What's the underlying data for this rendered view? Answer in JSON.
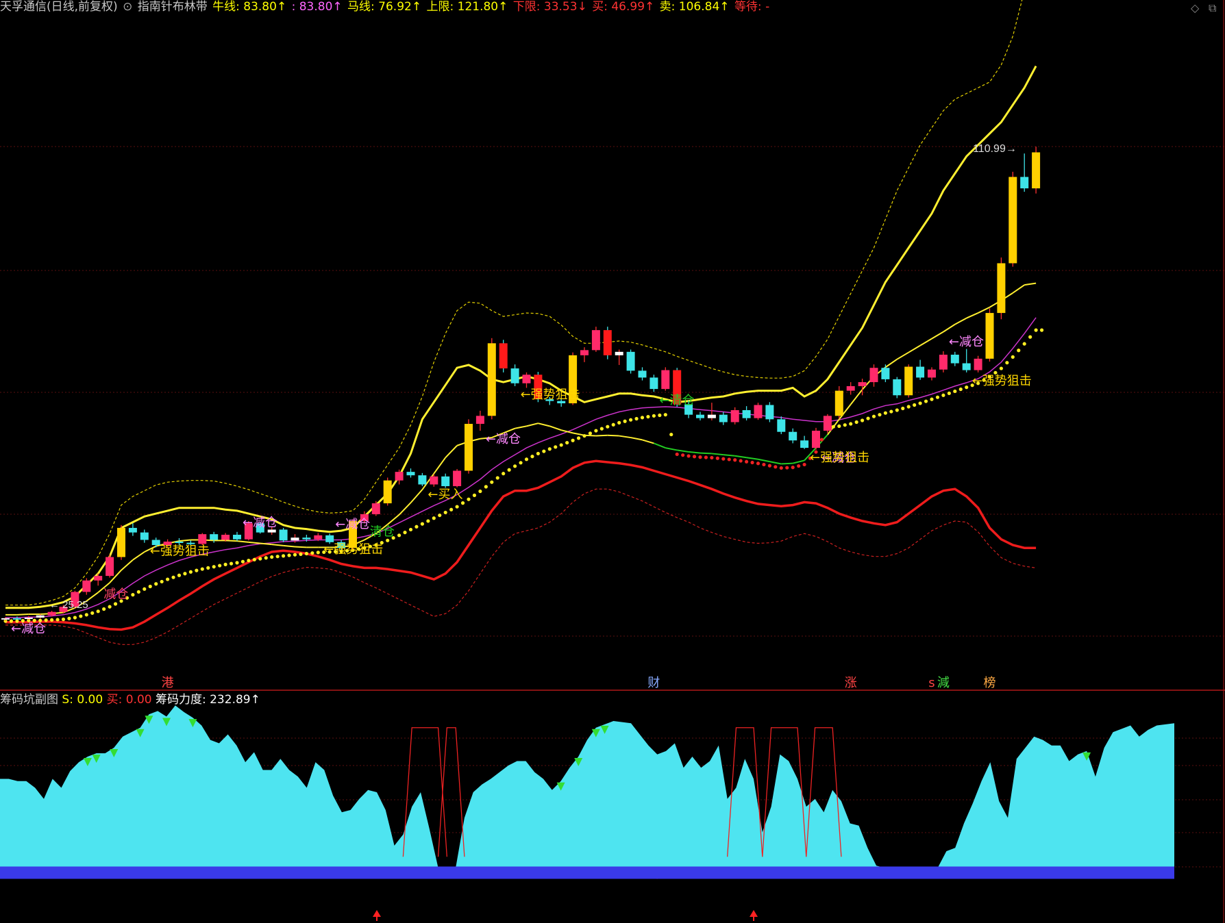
{
  "header": {
    "items": [
      {
        "text": "天孚通信(日线,前复权)",
        "color": "#c8c8c8"
      },
      {
        "text": "⊙",
        "color": "#aaaaaa"
      },
      {
        "text": "指南针布林带",
        "color": "#c8c8c8"
      },
      {
        "text": "牛线: 83.80↑",
        "color": "#ffff00"
      },
      {
        "text": ": 83.80↑",
        "color": "#ff66ff"
      },
      {
        "text": "马线: 76.92↑",
        "color": "#ffff00"
      },
      {
        "text": "上限: 121.80↑",
        "color": "#ffff00"
      },
      {
        "text": "下限: 33.53↓",
        "color": "#ff3333"
      },
      {
        "text": "买: 46.99↑",
        "color": "#ff3333"
      },
      {
        "text": "卖: 106.84↑",
        "color": "#ffff00"
      },
      {
        "text": "等待: -",
        "color": "#ff3333"
      }
    ]
  },
  "toolbar": {
    "diamond": "◇",
    "restore": "⧉"
  },
  "subheader": {
    "items": [
      {
        "text": "筹码坑副图",
        "color": "#c8c8c8"
      },
      {
        "text": "S: 0.00",
        "color": "#ffff00"
      },
      {
        "text": "买: 0.00",
        "color": "#ff3333"
      },
      {
        "text": "筹码力度: 232.89↑",
        "color": "#ffffff"
      }
    ]
  },
  "chart_data": {
    "type": "line",
    "candles": [
      [
        25.0,
        25.4,
        24.8,
        25.2
      ],
      [
        25.2,
        25.5,
        25.0,
        25.1
      ],
      [
        25.1,
        25.6,
        24.9,
        25.3
      ],
      [
        25.3,
        25.9,
        25.1,
        25.7
      ],
      [
        25.7,
        26.5,
        25.5,
        26.3
      ],
      [
        26.3,
        27.5,
        26.0,
        27.2
      ],
      [
        27.2,
        30.0,
        26.9,
        29.8
      ],
      [
        29.8,
        32.2,
        29.3,
        31.8
      ],
      [
        31.8,
        33.0,
        30.9,
        32.6
      ],
      [
        32.6,
        36.3,
        32.3,
        35.9
      ],
      [
        35.9,
        41.5,
        35.4,
        41.0
      ],
      [
        41.0,
        41.8,
        39.6,
        40.2
      ],
      [
        40.2,
        40.7,
        38.4,
        38.9
      ],
      [
        38.9,
        39.3,
        37.6,
        38.0
      ],
      [
        38.0,
        39.0,
        37.5,
        38.6
      ],
      [
        38.6,
        39.2,
        38.0,
        38.4
      ],
      [
        38.4,
        38.8,
        37.9,
        38.2
      ],
      [
        38.2,
        40.1,
        38.0,
        39.9
      ],
      [
        39.9,
        40.3,
        38.4,
        38.9
      ],
      [
        38.9,
        40.1,
        38.6,
        39.8
      ],
      [
        39.8,
        40.3,
        38.7,
        39.0
      ],
      [
        39.0,
        42.2,
        38.8,
        41.8
      ],
      [
        41.8,
        42.0,
        40.0,
        40.2
      ],
      [
        40.2,
        41.1,
        39.8,
        40.7
      ],
      [
        40.7,
        41.0,
        38.5,
        38.8
      ],
      [
        38.8,
        39.9,
        38.4,
        39.3
      ],
      [
        39.3,
        39.8,
        38.6,
        39.0
      ],
      [
        39.0,
        40.1,
        38.7,
        39.7
      ],
      [
        39.7,
        40.0,
        38.2,
        38.5
      ],
      [
        38.5,
        38.9,
        37.2,
        37.5
      ],
      [
        37.5,
        42.5,
        37.3,
        42.2
      ],
      [
        42.2,
        43.9,
        41.8,
        43.4
      ],
      [
        43.4,
        45.7,
        43.1,
        45.3
      ],
      [
        45.3,
        49.8,
        44.9,
        49.3
      ],
      [
        49.3,
        51.2,
        48.6,
        50.8
      ],
      [
        50.8,
        51.4,
        49.8,
        50.2
      ],
      [
        50.2,
        50.6,
        48.3,
        48.6
      ],
      [
        48.6,
        50.4,
        48.2,
        50.0
      ],
      [
        50.0,
        50.5,
        48.0,
        48.3
      ],
      [
        48.3,
        51.3,
        48.1,
        51.0
      ],
      [
        51.0,
        60.0,
        50.5,
        59.2
      ],
      [
        59.2,
        61.5,
        58.0,
        60.6
      ],
      [
        60.6,
        74.2,
        60.0,
        73.3
      ],
      [
        73.3,
        73.9,
        68.2,
        68.9
      ],
      [
        68.9,
        69.6,
        65.8,
        66.3
      ],
      [
        66.3,
        68.2,
        65.5,
        67.8
      ],
      [
        67.8,
        68.3,
        63.0,
        63.5
      ],
      [
        63.5,
        63.9,
        62.5,
        63.2
      ],
      [
        63.2,
        63.6,
        62.2,
        62.8
      ],
      [
        62.8,
        71.7,
        62.5,
        71.2
      ],
      [
        71.2,
        72.6,
        70.0,
        72.1
      ],
      [
        72.1,
        76.2,
        71.8,
        75.6
      ],
      [
        75.6,
        76.2,
        70.5,
        71.2
      ],
      [
        71.2,
        72.2,
        69.5,
        71.8
      ],
      [
        71.8,
        72.2,
        68.0,
        68.5
      ],
      [
        68.5,
        69.1,
        66.8,
        67.3
      ],
      [
        67.3,
        67.8,
        64.8,
        65.3
      ],
      [
        65.3,
        69.1,
        65.0,
        68.6
      ],
      [
        68.6,
        69.0,
        62.2,
        62.6
      ],
      [
        62.6,
        63.3,
        60.2,
        60.8
      ],
      [
        60.8,
        61.3,
        59.8,
        60.2
      ],
      [
        60.2,
        62.9,
        59.8,
        60.8
      ],
      [
        60.8,
        61.3,
        59.0,
        59.5
      ],
      [
        59.5,
        62.1,
        59.1,
        61.6
      ],
      [
        61.6,
        62.3,
        59.8,
        60.2
      ],
      [
        60.2,
        62.9,
        59.9,
        62.5
      ],
      [
        62.5,
        63.0,
        59.5,
        60.0
      ],
      [
        60.0,
        60.5,
        57.4,
        57.8
      ],
      [
        57.8,
        58.4,
        55.8,
        56.3
      ],
      [
        56.3,
        57.1,
        54.8,
        55.0
      ],
      [
        55.0,
        58.5,
        54.7,
        58.0
      ],
      [
        58.0,
        60.9,
        57.6,
        60.6
      ],
      [
        60.6,
        65.8,
        60.1,
        65.0
      ],
      [
        65.0,
        66.5,
        64.3,
        65.8
      ],
      [
        65.8,
        67.1,
        64.2,
        66.5
      ],
      [
        66.5,
        69.6,
        65.7,
        69.0
      ],
      [
        69.0,
        69.6,
        66.5,
        67.0
      ],
      [
        67.0,
        67.4,
        63.7,
        64.2
      ],
      [
        64.2,
        69.6,
        63.8,
        69.2
      ],
      [
        69.2,
        70.4,
        66.9,
        67.3
      ],
      [
        67.3,
        69.1,
        66.8,
        68.7
      ],
      [
        68.7,
        71.9,
        68.2,
        71.3
      ],
      [
        71.3,
        71.8,
        69.3,
        69.8
      ],
      [
        69.8,
        72.3,
        68.2,
        68.6
      ],
      [
        68.6,
        71.1,
        68.2,
        70.6
      ],
      [
        70.6,
        79.4,
        70.1,
        78.6
      ],
      [
        78.6,
        88.3,
        77.5,
        87.3
      ],
      [
        87.3,
        103.3,
        86.7,
        102.4
      ],
      [
        102.4,
        106.5,
        99.8,
        100.4
      ],
      [
        100.4,
        107.7,
        99.5,
        106.7
      ]
    ],
    "last_price_label": "110.99",
    "low_price_label": "25.25",
    "upper_band": [
      27,
      27,
      27,
      27.2,
      27.5,
      28,
      29,
      31,
      33,
      36,
      41,
      42,
      43,
      43.5,
      44,
      44.5,
      44.5,
      44.5,
      44.5,
      44.2,
      44,
      43.5,
      43,
      42.5,
      41.5,
      41,
      40.8,
      40.5,
      40.3,
      40.5,
      41,
      43,
      45,
      47,
      50,
      54,
      60,
      63,
      66,
      69,
      69.5,
      68.5,
      67,
      66.5,
      67,
      67.5,
      67,
      66.3,
      65,
      64,
      63,
      63.5,
      64,
      64.5,
      64.5,
      64.2,
      64,
      63.5,
      63,
      63.2,
      63.5,
      63.8,
      64,
      64.5,
      64.8,
      65,
      65,
      65,
      65.5,
      64,
      65,
      67,
      70,
      73,
      76,
      80,
      84,
      87,
      90,
      93,
      96,
      100,
      103,
      106,
      108,
      110,
      112,
      115,
      118,
      121.8
    ],
    "middle_band": [
      25.8,
      25.8,
      25.9,
      25.9,
      26,
      26.2,
      27,
      28.2,
      29.7,
      31.4,
      33.6,
      35.4,
      36.8,
      37.8,
      38.3,
      38.7,
      38.9,
      38.9,
      38.8,
      38.8,
      38.7,
      38.5,
      38.3,
      38.1,
      37.9,
      37.7,
      37.6,
      37.6,
      37.6,
      37.6,
      38,
      38.9,
      40,
      41.6,
      43.3,
      45.4,
      47.7,
      50.5,
      53.3,
      55.4,
      56.1,
      56.6,
      56.8,
      57.6,
      58.4,
      58.8,
      59.3,
      58.8,
      58.1,
      57.6,
      57.2,
      57.1,
      57.2,
      57.1,
      56.8,
      56.4,
      55.8,
      55,
      54.6,
      54.3,
      54.1,
      54,
      53.8,
      53.6,
      53.3,
      53,
      52.6,
      52.2,
      52.3,
      52.8,
      55,
      57.3,
      60,
      62.6,
      65.2,
      67.5,
      69.1,
      70.5,
      71.7,
      72.9,
      74.1,
      75.3,
      76.6,
      77.7,
      78.6,
      79.6,
      80.8,
      82.1,
      83.5,
      83.8
    ],
    "lower_band": [
      24.5,
      24.5,
      24.5,
      24.6,
      24.6,
      24.5,
      24.3,
      24,
      23.6,
      23.3,
      23.2,
      23.6,
      24.6,
      25.8,
      27,
      28.3,
      29.5,
      30.8,
      32,
      33,
      34,
      35,
      36,
      36.8,
      37,
      36.8,
      36.5,
      36,
      35.4,
      34.7,
      34.3,
      34,
      34,
      33.8,
      33.5,
      33.2,
      32.6,
      32,
      33,
      35,
      38,
      41,
      44,
      46.5,
      47.5,
      47.5,
      48,
      49,
      50,
      51.5,
      52.4,
      52.7,
      52.5,
      52.3,
      52,
      51.6,
      51,
      50.4,
      49.8,
      49.2,
      48.5,
      47.8,
      47,
      46.3,
      45.7,
      45.2,
      45,
      44.8,
      45,
      45.5,
      45.3,
      44.5,
      43.5,
      42.8,
      42.2,
      41.8,
      41.5,
      42,
      43.5,
      45,
      46.5,
      47.5,
      47.8,
      46.5,
      44.5,
      41,
      39,
      38,
      37.5,
      37.5
    ],
    "outer_upper": [
      27.5,
      27.5,
      27.5,
      27.8,
      28.3,
      29,
      30.5,
      33,
      36,
      40,
      45,
      46.5,
      47.5,
      48.5,
      49,
      49.2,
      49.3,
      49.3,
      49.2,
      48.8,
      48.3,
      47.7,
      47,
      46.3,
      45.5,
      44.8,
      44.2,
      43.8,
      43.6,
      43.7,
      44,
      46,
      49,
      52,
      55,
      59,
      64,
      70,
      75,
      79,
      80.5,
      80.3,
      79,
      78,
      78.3,
      78.6,
      78.5,
      78,
      76.5,
      74.5,
      73.3,
      73.3,
      73.5,
      73.7,
      73.5,
      73,
      72.4,
      71.8,
      71,
      70.3,
      69.6,
      68.9,
      68.3,
      67.8,
      67.5,
      67.3,
      67.2,
      67.2,
      67.5,
      68.5,
      71,
      74,
      78,
      82,
      86,
      90,
      95,
      100,
      104,
      108,
      111,
      114,
      116,
      117,
      118,
      119,
      122,
      127,
      135,
      147
    ],
    "outer_lower": [
      24,
      24,
      24,
      24,
      24,
      23.8,
      23.4,
      22.6,
      21.8,
      21,
      20.6,
      20.6,
      21,
      21.8,
      22.8,
      24,
      25.2,
      26.4,
      27.6,
      28.6,
      29.6,
      30.6,
      31.6,
      32.5,
      33.2,
      33.7,
      34.1,
      34,
      33.8,
      33.2,
      32.4,
      31.4,
      30.5,
      29.5,
      28.5,
      27.5,
      26.5,
      25.5,
      26,
      27.5,
      30,
      33,
      36,
      38.5,
      40,
      40.5,
      41,
      42,
      43.5,
      45.5,
      47,
      47.8,
      47.8,
      47.3,
      46.5,
      45.7,
      44.7,
      43.7,
      42.8,
      42,
      41,
      40.2,
      39.5,
      39,
      38.5,
      38.3,
      38.4,
      38.7,
      39.5,
      40,
      39.5,
      38.6,
      37.5,
      36.8,
      36.3,
      36,
      36,
      36.5,
      37.5,
      39,
      40.5,
      41.5,
      42.2,
      42,
      40.3,
      37.8,
      35.8,
      34.8,
      34.3,
      34
    ],
    "ma_line": [
      25.3,
      25.3,
      25.4,
      25.4,
      25.6,
      25.8,
      26.2,
      26.8,
      27.6,
      28.6,
      29.9,
      31.3,
      32.6,
      33.6,
      34.5,
      35.3,
      35.9,
      36.4,
      36.8,
      37.2,
      37.5,
      37.9,
      38.2,
      38.4,
      38.6,
      38.7,
      38.8,
      38.9,
      38.9,
      38.9,
      39.1,
      39.5,
      40,
      40.9,
      41.9,
      42.9,
      43.9,
      44.9,
      45.8,
      46.8,
      48.1,
      49.5,
      51.2,
      52.6,
      53.8,
      55,
      55.9,
      56.7,
      57.4,
      58.2,
      59.1,
      60,
      60.7,
      61.3,
      61.7,
      62,
      62.1,
      62.2,
      62.1,
      61.9,
      61.7,
      61.5,
      61.3,
      61.1,
      60.9,
      60.7,
      60.5,
      60.3,
      60,
      59.8,
      59.6,
      59.6,
      59.9,
      60.4,
      61,
      61.8,
      62.4,
      62.7,
      63.3,
      63.8,
      64.4,
      65.1,
      65.8,
      66.4,
      67.1,
      68.3,
      70,
      72.4,
      75,
      77.8
    ],
    "dot_line": [
      24.7,
      24.7,
      24.8,
      24.8,
      24.9,
      25,
      25.3,
      25.8,
      26.4,
      27.2,
      28.2,
      29.3,
      30.3,
      31.2,
      32,
      32.7,
      33.3,
      33.8,
      34.2,
      34.6,
      34.9,
      35.3,
      35.6,
      35.9,
      36.1,
      36.3,
      36.5,
      36.7,
      36.8,
      36.9,
      37.1,
      37.5,
      38,
      38.8,
      39.7,
      40.7,
      41.7,
      42.7,
      43.7,
      44.7,
      46,
      47.4,
      49,
      50.5,
      51.8,
      53,
      54,
      54.8,
      55.5,
      56.3,
      57.1,
      58,
      58.7,
      59.4,
      59.9,
      60.3,
      60.6,
      60.8,
      60.9,
      60.9,
      60.8,
      60.7,
      60.5,
      60.3,
      60.1,
      59.9,
      59.7,
      59.4,
      59.1,
      58.8,
      58.6,
      58.6,
      58.8,
      59.2,
      59.8,
      60.5,
      61.1,
      61.6,
      62.2,
      62.8,
      63.5,
      64.2,
      64.9,
      65.6,
      66.3,
      67.4,
      68.9,
      70.9,
      73.2,
      75.6
    ],
    "annotations": [
      {
        "i": 0,
        "text": "←减仓",
        "color": "#ff88ff",
        "dy": 1
      },
      {
        "i": 8,
        "text": "减仓",
        "color": "#ff4466",
        "dy": 1
      },
      {
        "i": 12,
        "text": "←强势狙击",
        "color": "#ffd700",
        "dy": 1
      },
      {
        "i": 20,
        "text": "←减仓",
        "color": "#ff88ff",
        "dy": -1
      },
      {
        "i": 28,
        "text": "←减仓",
        "color": "#ff88ff",
        "dy": -1
      },
      {
        "i": 27,
        "text": "←强势狙击",
        "color": "#ffd700",
        "dy": 1
      },
      {
        "i": 31,
        "text": "清仓",
        "color": "#22cc22",
        "dy": 1
      },
      {
        "i": 36,
        "text": "←买入",
        "color": "#ffd700",
        "dy": 1
      },
      {
        "i": 41,
        "text": "←减仓",
        "color": "#ff88ff",
        "dy": 1
      },
      {
        "i": 44,
        "text": "←强势狙击",
        "color": "#ffd700",
        "dy": 1
      },
      {
        "i": 56,
        "text": "←清仓",
        "color": "#22cc22",
        "dy": 1
      },
      {
        "i": 70,
        "text": "←减仓",
        "color": "#ff88ff",
        "dy": 1
      },
      {
        "i": 69,
        "text": "←强势狙击",
        "color": "#ffd700",
        "dy": 1
      },
      {
        "i": 81,
        "text": "←减仓",
        "color": "#ff88ff",
        "dy": -1
      },
      {
        "i": 83,
        "text": "←强势狙击",
        "color": "#ffd700",
        "dy": 1
      }
    ],
    "event_labels": [
      {
        "i": 14,
        "text": "港",
        "color": "#ff4444"
      },
      {
        "i": 56,
        "text": "财",
        "color": "#88aaff"
      },
      {
        "i": 73,
        "text": "涨",
        "color": "#ff4444"
      },
      {
        "i": 80,
        "text": "s",
        "color": "#ff4444"
      },
      {
        "i": 81,
        "text": "減",
        "color": "#44dd44"
      },
      {
        "i": 85,
        "text": "榜",
        "color": "#ffaa44"
      }
    ],
    "sub": {
      "area": [
        80,
        80,
        78,
        78,
        72,
        62,
        80,
        72,
        87,
        95,
        100,
        103,
        103,
        108,
        118,
        122,
        126,
        138,
        141,
        136,
        146,
        140,
        135,
        128,
        115,
        112,
        120,
        110,
        95,
        104,
        88,
        88,
        98,
        88,
        82,
        72,
        95,
        88,
        65,
        50,
        52,
        62,
        70,
        68,
        52,
        20,
        30,
        55,
        68,
        35,
        0,
        0,
        0,
        45,
        68,
        75,
        80,
        86,
        92,
        96,
        96,
        86,
        80,
        70,
        78,
        90,
        100,
        115,
        126,
        129,
        132,
        131,
        130,
        120,
        110,
        102,
        105,
        112,
        90,
        100,
        90,
        96,
        110,
        62,
        72,
        98,
        80,
        32,
        55,
        102,
        96,
        80,
        55,
        62,
        50,
        70,
        60,
        40,
        38,
        18,
        2,
        -10,
        -15,
        0,
        -8,
        -15,
        -10,
        0,
        15,
        18,
        40,
        58,
        78,
        95,
        60,
        45,
        98,
        108,
        118,
        115,
        110,
        110,
        96,
        102,
        105,
        82,
        108,
        122,
        125,
        128,
        118,
        124,
        128,
        129,
        130
      ],
      "red_area": [
        -18,
        -24,
        -24,
        -24,
        -18,
        -10,
        0
      ],
      "ylim": [
        -20,
        140
      ]
    }
  }
}
